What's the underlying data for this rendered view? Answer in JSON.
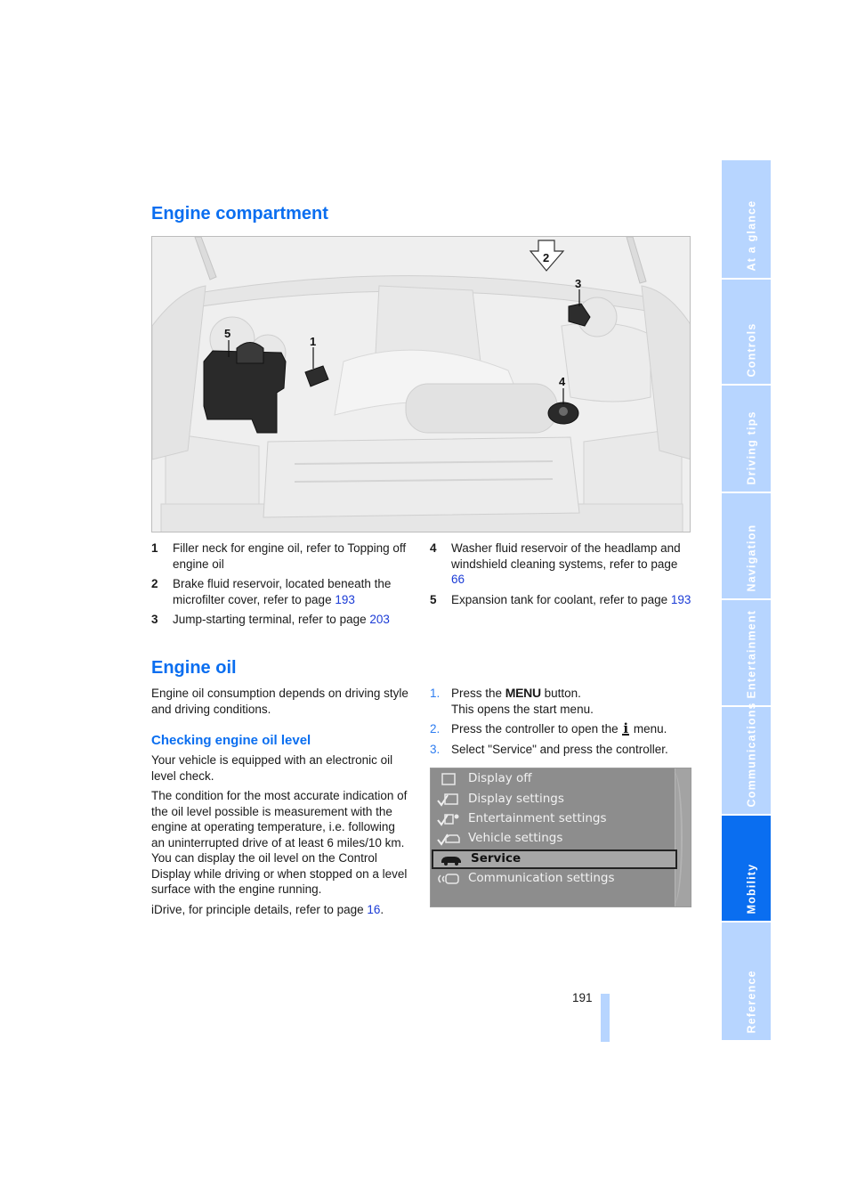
{
  "sections": {
    "engine_compartment": {
      "title": "Engine compartment",
      "figure_callouts": [
        "1",
        "2",
        "3",
        "4",
        "5"
      ],
      "legend_left": [
        {
          "num": "1",
          "text": "Filler neck for engine oil, refer to Topping off engine oil",
          "link": ""
        },
        {
          "num": "2",
          "text": "Brake fluid reservoir, located beneath the microfilter cover, refer to page ",
          "link": "193"
        },
        {
          "num": "3",
          "text": "Jump-starting terminal, refer to page ",
          "link": "203"
        }
      ],
      "legend_right": [
        {
          "num": "4",
          "text": "Washer fluid reservoir of the headlamp and windshield cleaning systems, refer to page ",
          "link": "66"
        },
        {
          "num": "5",
          "text": "Expansion tank for coolant, refer to page ",
          "link": "193"
        }
      ]
    },
    "engine_oil": {
      "title": "Engine oil",
      "intro": "Engine oil consumption depends on driving style and driving conditions.",
      "subheading": "Checking engine oil level",
      "para1": "Your vehicle is equipped with an electronic oil level check.",
      "para2": "The condition for the most accurate indication of the oil level possible is measurement with the engine at operating temperature, i.e. following an uninterrupted drive of at least 6 miles/10 km. You can display the oil level on the Control Display while driving or when stopped on a level surface with the engine running.",
      "para3_text": "iDrive, for principle details, refer to page ",
      "para3_link": "16",
      "para3_end": ".",
      "steps": [
        {
          "num": "1.",
          "pre": "Press the ",
          "key": "MENU",
          "post": " button.",
          "line2": "This opens the start menu."
        },
        {
          "num": "2.",
          "pre": "Press the controller to open the ",
          "key": "i",
          "post": " menu."
        },
        {
          "num": "3.",
          "pre": "Select \"Service\" and press the controller."
        }
      ]
    }
  },
  "idrive_menu": {
    "items": [
      {
        "icon": "checkbox-icon",
        "label": "Display off",
        "selected": false
      },
      {
        "icon": "display-settings-icon",
        "label": "Display settings",
        "selected": false
      },
      {
        "icon": "entertainment-settings-icon",
        "label": "Entertainment settings",
        "selected": false
      },
      {
        "icon": "vehicle-settings-icon",
        "label": "Vehicle settings",
        "selected": false
      },
      {
        "icon": "service-car-icon",
        "label": "Service",
        "selected": true
      },
      {
        "icon": "communication-settings-icon",
        "label": "Communication settings",
        "selected": false
      }
    ]
  },
  "thumb_tabs": [
    {
      "label": "At a glance",
      "active": false
    },
    {
      "label": "Controls",
      "active": false
    },
    {
      "label": "Driving tips",
      "active": false
    },
    {
      "label": "Navigation",
      "active": false
    },
    {
      "label": "Entertainment",
      "active": false
    },
    {
      "label": "Communications",
      "active": false
    },
    {
      "label": "Mobility",
      "active": true
    },
    {
      "label": "Reference",
      "active": false
    }
  ],
  "page_number": "191",
  "colors": {
    "heading_blue": "#0a6ef0",
    "link_blue": "#1a3bd6",
    "tab_inactive": "#b7d5ff",
    "tab_active": "#0a6ef0"
  }
}
